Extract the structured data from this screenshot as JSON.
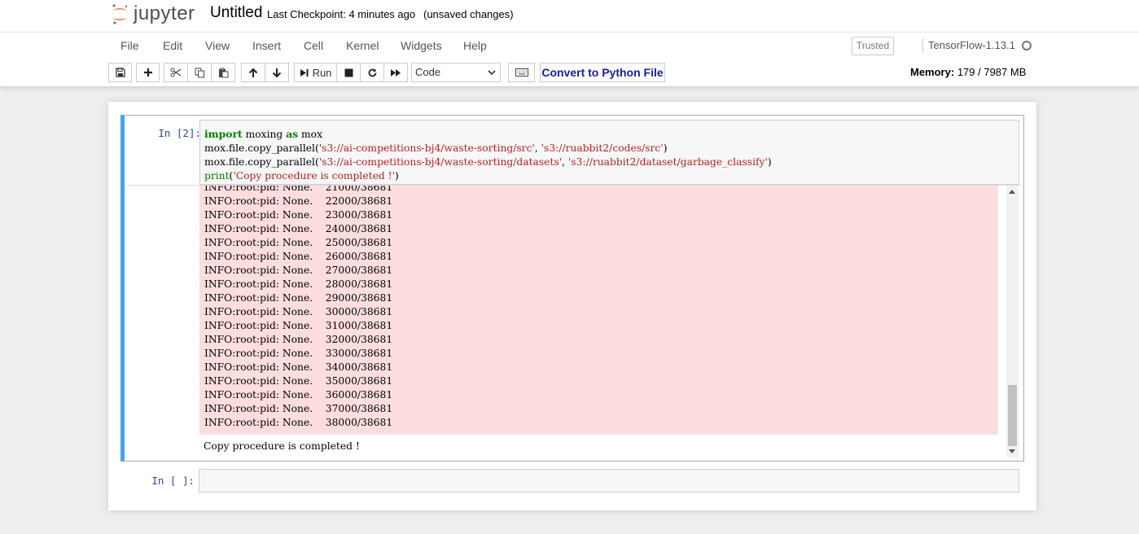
{
  "header": {
    "logo_text": "jupyter",
    "notebook_title": "Untitled",
    "checkpoint": "Last Checkpoint: 4 minutes ago",
    "autosave_status": "(unsaved changes)"
  },
  "menubar": {
    "items": [
      "File",
      "Edit",
      "View",
      "Insert",
      "Cell",
      "Kernel",
      "Widgets",
      "Help"
    ],
    "trusted_label": "Trusted",
    "kernel_name": "TensorFlow-1.13.1"
  },
  "toolbar": {
    "buttons": [
      "save-icon",
      "plus-icon",
      "cut-icon",
      "copy-icon",
      "paste-icon",
      "arrow-up-icon",
      "arrow-down-icon",
      "run",
      "stop-icon",
      "restart-icon",
      "fast-forward-icon",
      "keyboard-icon"
    ],
    "run_label": "Run",
    "cell_type": "Code",
    "convert_label": "Convert to Python File",
    "memory_label": "Memory:",
    "memory_value": "179 / 7987 MB"
  },
  "cells": [
    {
      "prompt": "In  [2]:",
      "code_lines": [
        "import moxing as mox",
        "mox.file.copy_parallel('s3://ai-competitions-bj4/waste-sorting/src', 's3://ruabbit2/codes/src')",
        "mox.file.copy_parallel('s3://ai-competitions-bj4/waste-sorting/datasets', 's3://ruabbit2/dataset/garbage_classify')",
        "print('Copy procedure is completed !')"
      ],
      "stderr_lines": [
        "INFO:root:pid: None.    21000/38681",
        "INFO:root:pid: None.    22000/38681",
        "INFO:root:pid: None.    23000/38681",
        "INFO:root:pid: None.    24000/38681",
        "INFO:root:pid: None.    25000/38681",
        "INFO:root:pid: None.    26000/38681",
        "INFO:root:pid: None.    27000/38681",
        "INFO:root:pid: None.    28000/38681",
        "INFO:root:pid: None.    29000/38681",
        "INFO:root:pid: None.    30000/38681",
        "INFO:root:pid: None.    31000/38681",
        "INFO:root:pid: None.    32000/38681",
        "INFO:root:pid: None.    33000/38681",
        "INFO:root:pid: None.    34000/38681",
        "INFO:root:pid: None.    35000/38681",
        "INFO:root:pid: None.    36000/38681",
        "INFO:root:pid: None.    37000/38681",
        "INFO:root:pid: None.    38000/38681"
      ],
      "stdout": "Copy procedure is completed !"
    },
    {
      "prompt": "In  [ ]:"
    }
  ],
  "colors": {
    "selected_cell_border": "#42a5f5",
    "stderr_background": "#fddddd",
    "prompt": "#303f9f",
    "keyword": "#008000",
    "string": "#ba2121"
  }
}
